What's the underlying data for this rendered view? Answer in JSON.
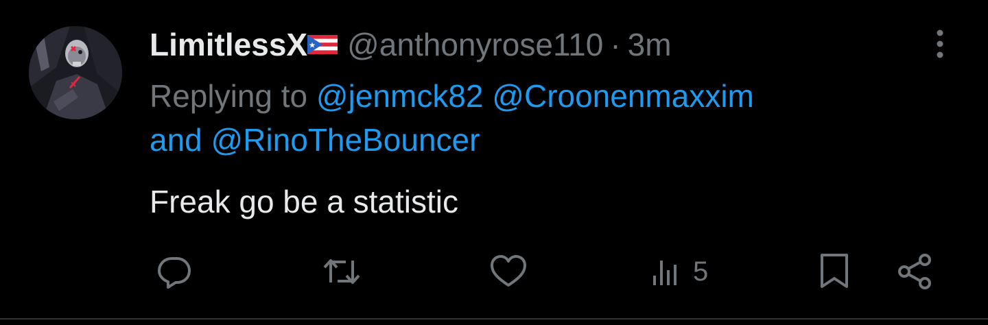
{
  "tweet": {
    "display_name": "LimitlessX",
    "handle": "@anthonyrose110",
    "separator": "·",
    "time": "3m",
    "reply_prefix": "Replying to",
    "mentions": [
      "@jenmck82",
      "@Croonenmaxxim"
    ],
    "reply_joiner": "and",
    "last_mention": "@RinoTheBouncer",
    "text": "Freak go be a statistic"
  },
  "actions": {
    "views_count": "5"
  },
  "colors": {
    "background": "#000000",
    "primary_text": "#e7e9ea",
    "secondary_text": "#71767b",
    "link": "#1d9bf0",
    "divider": "#2f3336"
  },
  "icons": {
    "flag": "puerto-rico-flag-icon",
    "more": "more-vertical-icon",
    "reply": "reply-icon",
    "retweet": "retweet-icon",
    "like": "heart-icon",
    "views": "views-icon",
    "bookmark": "bookmark-icon",
    "share": "share-icon"
  }
}
